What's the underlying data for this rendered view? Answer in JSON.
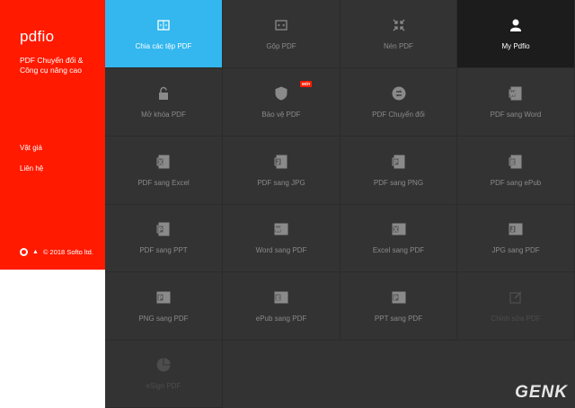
{
  "sidebar": {
    "logo": "pdfio",
    "tagline": "PDF Chuyển đổi & Công cụ nâng cao",
    "links": {
      "pricing": "Vật giá",
      "contact": "Liên hệ"
    },
    "copyright": "© 2018 Softo ltd."
  },
  "tiles": [
    {
      "label": "Chia các tệp PDF",
      "icon": "split-icon"
    },
    {
      "label": "Gộp PDF",
      "icon": "merge-icon"
    },
    {
      "label": "Nén PDF",
      "icon": "compress-icon"
    },
    {
      "label": "My Pdfio",
      "icon": "user-icon"
    },
    {
      "label": "Mở khóa PDF",
      "icon": "unlock-icon"
    },
    {
      "label": "Bảo vệ PDF",
      "icon": "shield-icon",
      "badge": "MỚI"
    },
    {
      "label": "PDF Chuyển đổi",
      "icon": "convert-icon"
    },
    {
      "label": "PDF sang Word",
      "icon": "word-icon"
    },
    {
      "label": "PDF sang Excel",
      "icon": "excel-icon"
    },
    {
      "label": "PDF sang JPG",
      "icon": "jpg-icon"
    },
    {
      "label": "PDF sang PNG",
      "icon": "png-icon"
    },
    {
      "label": "PDF sang ePub",
      "icon": "epub-icon"
    },
    {
      "label": "PDF sang PPT",
      "icon": "ppt-icon"
    },
    {
      "label": "Word sang PDF",
      "icon": "word-to-pdf-icon"
    },
    {
      "label": "Excel sang PDF",
      "icon": "excel-to-pdf-icon"
    },
    {
      "label": "JPG sang PDF",
      "icon": "jpg-to-pdf-icon"
    },
    {
      "label": "PNG sang PDF",
      "icon": "png-to-pdf-icon"
    },
    {
      "label": "ePub sang PDF",
      "icon": "epub-to-pdf-icon"
    },
    {
      "label": "PPT sang PDF",
      "icon": "ppt-to-pdf-icon"
    },
    {
      "label": "Chỉnh sửa PDF",
      "icon": "edit-icon"
    },
    {
      "label": "eSign PDF",
      "icon": "esign-icon"
    }
  ],
  "watermark": "GENK"
}
